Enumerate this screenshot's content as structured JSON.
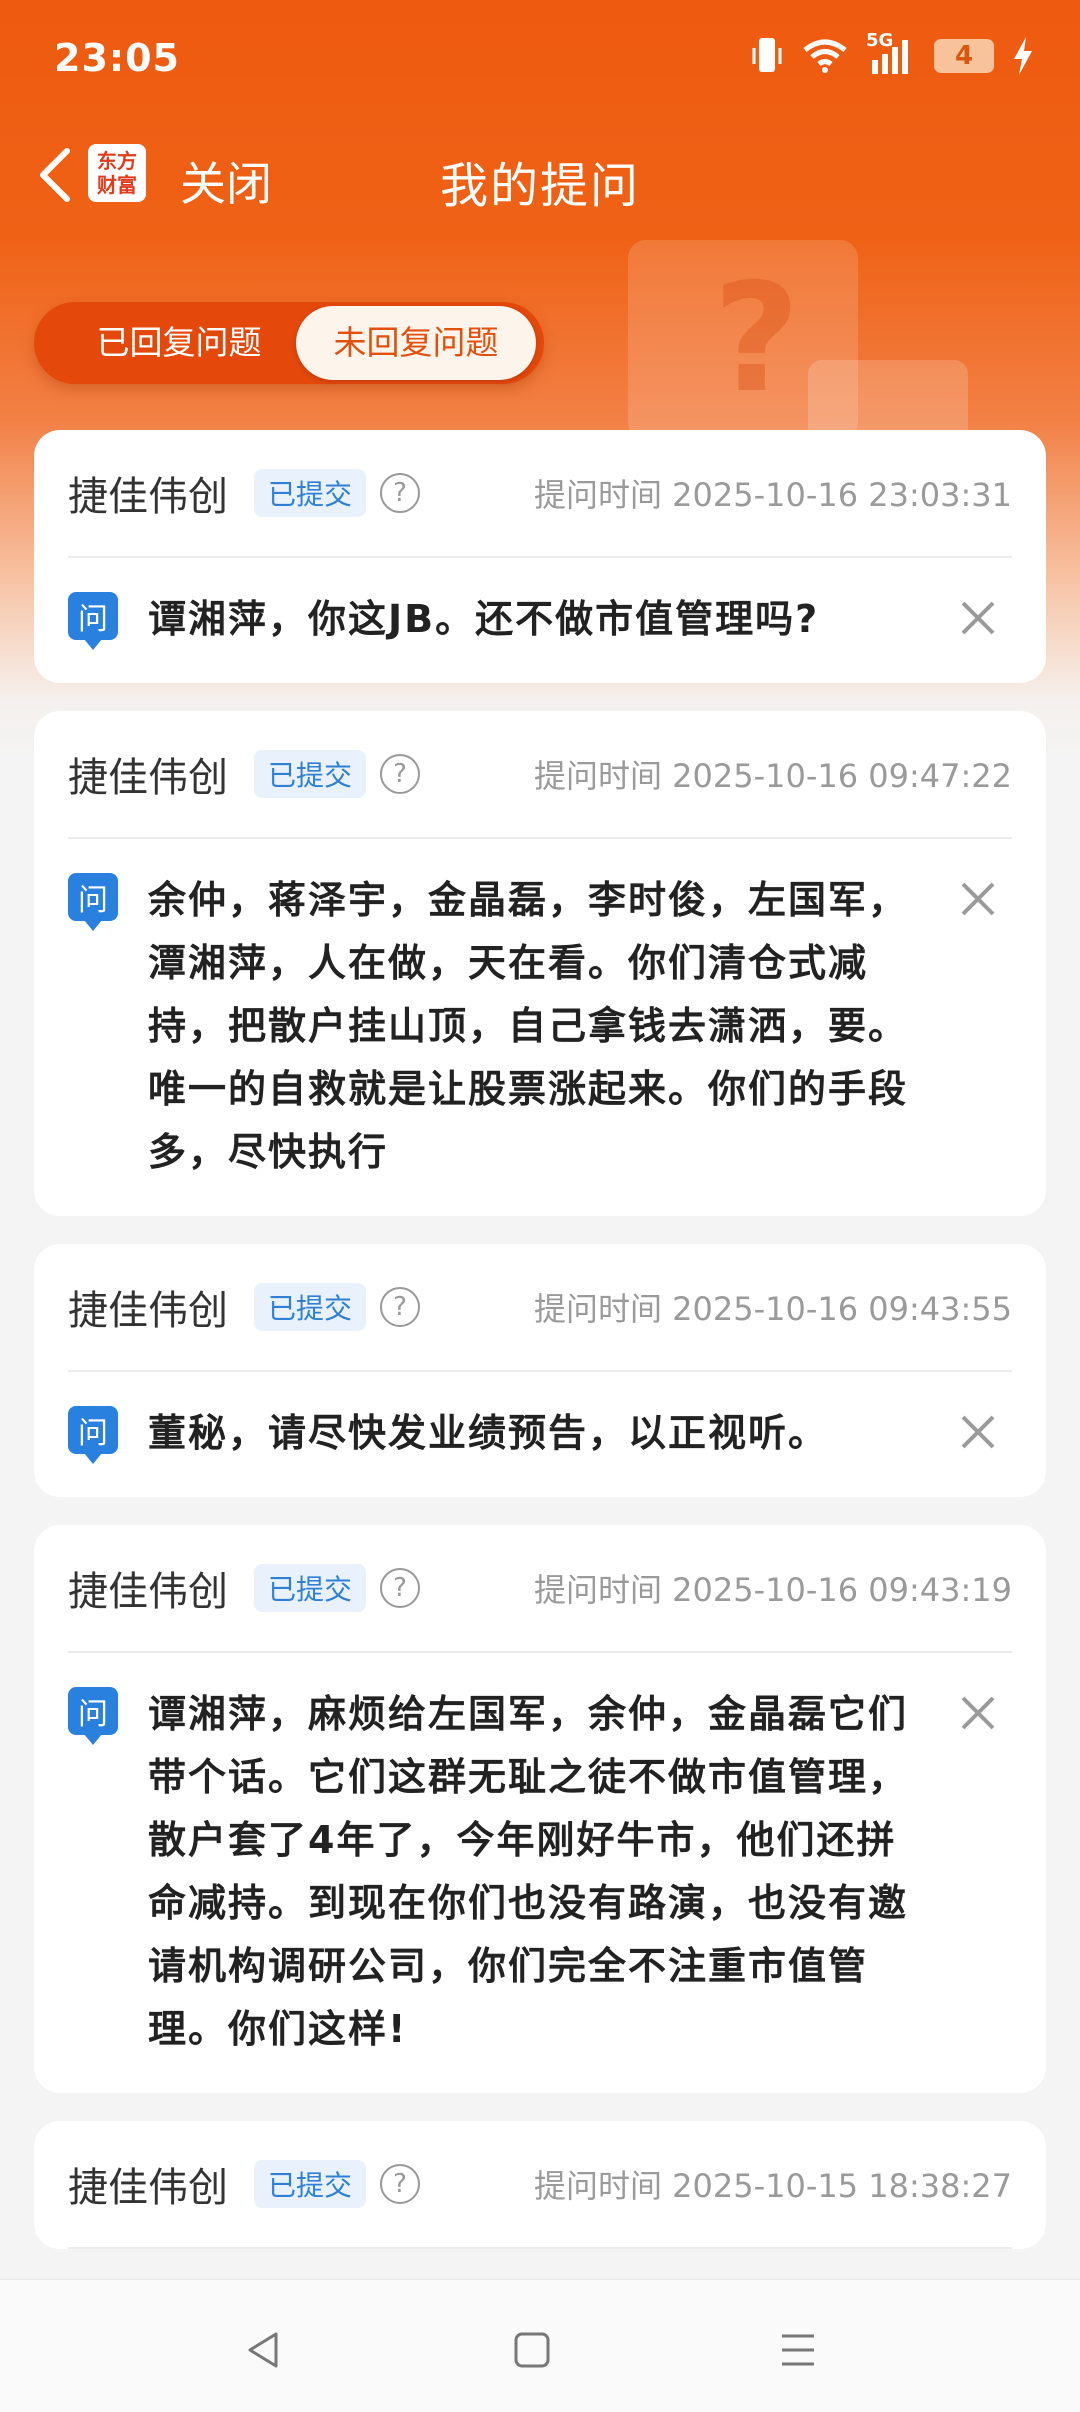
{
  "status_bar": {
    "time": "23:05",
    "network": "5G",
    "battery": "4"
  },
  "header": {
    "logo_line1": "东方",
    "logo_line2": "财富",
    "close_label": "关闭",
    "title": "我的提问"
  },
  "tabs": {
    "answered": "已回复问题",
    "unanswered": "未回复问题",
    "selected": "未回复问题"
  },
  "questions": [
    {
      "company": "捷佳伟创",
      "status": "已提交",
      "time": "提问时间 2025-10-16 23:03:31",
      "text": "谭湘萍，你这JB。还不做市值管理吗?"
    },
    {
      "company": "捷佳伟创",
      "status": "已提交",
      "time": "提问时间 2025-10-16 09:47:22",
      "text": "余仲，蒋泽宇，金晶磊，李时俊，左国军，潭湘萍，人在做，天在看。你们清仓式减持，把散户挂山顶，自己拿钱去潇洒，要。唯一的自救就是让股票涨起来。你们的手段多，尽快执行"
    },
    {
      "company": "捷佳伟创",
      "status": "已提交",
      "time": "提问时间 2025-10-16 09:43:55",
      "text": "董秘，请尽快发业绩预告，以正视听。"
    },
    {
      "company": "捷佳伟创",
      "status": "已提交",
      "time": "提问时间 2025-10-16 09:43:19",
      "text": "谭湘萍，麻烦给左国军，余仲，金晶磊它们带个话。它们这群无耻之徒不做市值管理，散户套了4年了，今年刚好牛市，他们还拼命减持。到现在你们也没有路演，也没有邀请机构调研公司，你们完全不注重市值管理。你们这样!"
    },
    {
      "company": "捷佳伟创",
      "status": "已提交",
      "time": "提问时间 2025-10-15 18:38:27",
      "text": ""
    }
  ],
  "q_icon_label": "问",
  "help_label": "?",
  "colors": {
    "brand": "#ee5a10",
    "badge": "#2f7fd6",
    "q_icon": "#2a80de"
  }
}
